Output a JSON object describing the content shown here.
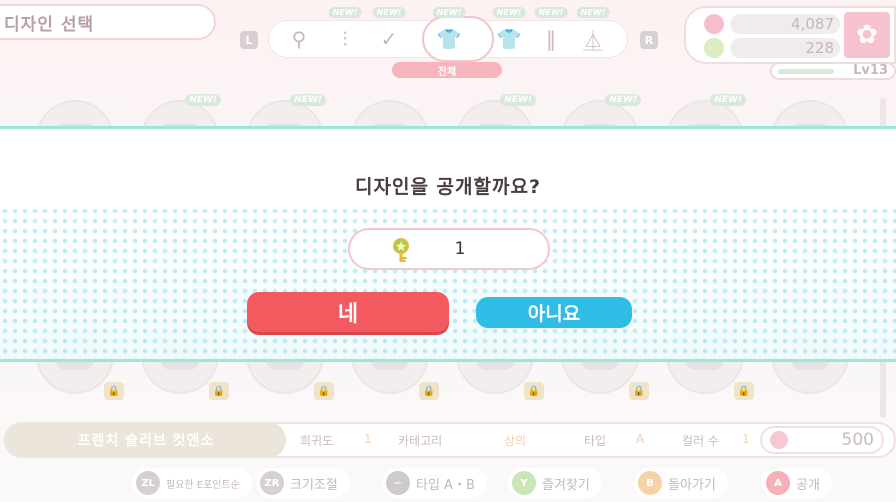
{
  "header": {
    "title": "디자인 선택"
  },
  "shoulder_buttons": {
    "left": "L",
    "right": "R"
  },
  "categories": {
    "new_badge": "NEW!",
    "selected_label": "전체",
    "items": [
      {
        "icon": "glasses-icon",
        "glyph": "⚲",
        "new": false
      },
      {
        "icon": "earrings-icon",
        "glyph": "⫶",
        "new": true
      },
      {
        "icon": "check-icon",
        "glyph": "✓",
        "new": true
      },
      {
        "icon": "all-clothes-icon",
        "glyph": "👕",
        "new": true
      },
      {
        "icon": "tshirt-icon",
        "glyph": "👕",
        "new": true
      },
      {
        "icon": "pants-icon",
        "glyph": "‖",
        "new": true
      },
      {
        "icon": "dress-icon",
        "glyph": "⏅",
        "new": true
      }
    ]
  },
  "currency": {
    "stars": "4,087",
    "keys": "228"
  },
  "level": {
    "label": "Lv13",
    "progress": 0.45
  },
  "item_info": {
    "name": "프렌치 슬리브 컷앤소",
    "rarity_label": "희귀도",
    "rarity_value": "1",
    "category_label": "카테고리",
    "category_value": "상의",
    "type_label": "타입",
    "type_value": "A",
    "colors_label": "컬러 수",
    "colors_value": "1",
    "points": "500"
  },
  "controls": [
    {
      "key": "ZL",
      "label": "필요한 E포인트순",
      "color": "#d7d0d2"
    },
    {
      "key": "ZR",
      "label": "크기조절",
      "color": "#d7d0d2"
    },
    {
      "key": "−",
      "label": "타입 A・B",
      "color": "#cfcacb"
    },
    {
      "key": "Y",
      "label": "즐겨찾기",
      "color": "#c9e6b4"
    },
    {
      "key": "B",
      "label": "돌아가기",
      "color": "#f6d3a6"
    },
    {
      "key": "A",
      "label": "공개",
      "color": "#f4b2b8"
    }
  ],
  "dialog": {
    "message": "디자인을 공개할까요?",
    "cost_value": "1",
    "yes_label": "네",
    "no_label": "아니요"
  }
}
